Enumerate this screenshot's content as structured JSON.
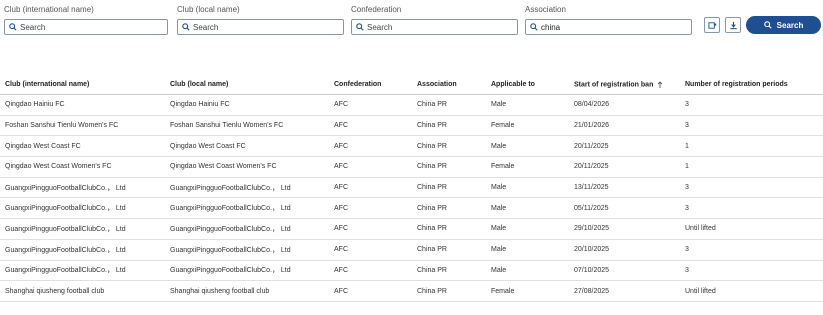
{
  "filters": {
    "club_international": {
      "label": "Club (international name)",
      "placeholder": "Search",
      "value": ""
    },
    "club_local": {
      "label": "Club (local name)",
      "placeholder": "Search",
      "value": ""
    },
    "confederation": {
      "label": "Confederation",
      "placeholder": "Search",
      "value": ""
    },
    "association": {
      "label": "Association",
      "placeholder": "Search",
      "value": "china"
    },
    "search_button": "Search"
  },
  "colors": {
    "accent": "#1f4f91",
    "border": "#8a96a8"
  },
  "table": {
    "headers": {
      "club_international": "Club (international name)",
      "club_local": "Club (local name)",
      "confederation": "Confederation",
      "association": "Association",
      "applicable_to": "Applicable to",
      "start_ban": "Start of registration ban",
      "periods": "Number of registration periods"
    },
    "rows": [
      {
        "club_international": "Qingdao Hainiu FC",
        "club_local": "Qingdao Hainiu FC",
        "confederation": "AFC",
        "association": "China PR",
        "applicable_to": "Male",
        "start_ban": "08/04/2026",
        "periods": "3"
      },
      {
        "club_international": "Foshan Sanshui Tienlu Women's FC",
        "club_local": "Foshan Sanshui Tienlu Women's FC",
        "confederation": "AFC",
        "association": "China PR",
        "applicable_to": "Female",
        "start_ban": "21/01/2026",
        "periods": "3"
      },
      {
        "club_international": "Qingdao West Coast FC",
        "club_local": "Qingdao West Coast FC",
        "confederation": "AFC",
        "association": "China PR",
        "applicable_to": "Male",
        "start_ban": "20/11/2025",
        "periods": "1"
      },
      {
        "club_international": "Qingdao West Coast Women's FC",
        "club_local": "Qingdao West Coast Women's FC",
        "confederation": "AFC",
        "association": "China PR",
        "applicable_to": "Female",
        "start_ban": "20/11/2025",
        "periods": "1"
      },
      {
        "club_international": "GuangxiPingguoFootballClubCo.， Ltd",
        "club_local": "GuangxiPingguoFootballClubCo.， Ltd",
        "confederation": "AFC",
        "association": "China PR",
        "applicable_to": "Male",
        "start_ban": "13/11/2025",
        "periods": "3"
      },
      {
        "club_international": "GuangxiPingguoFootballClubCo.， Ltd",
        "club_local": "GuangxiPingguoFootballClubCo.， Ltd",
        "confederation": "AFC",
        "association": "China PR",
        "applicable_to": "Male",
        "start_ban": "05/11/2025",
        "periods": "3"
      },
      {
        "club_international": "GuangxiPingguoFootballClubCo.， Ltd",
        "club_local": "GuangxiPingguoFootballClubCo.， Ltd",
        "confederation": "AFC",
        "association": "China PR",
        "applicable_to": "Male",
        "start_ban": "29/10/2025",
        "periods": "Until lifted"
      },
      {
        "club_international": "GuangxiPingguoFootballClubCo.， Ltd",
        "club_local": "GuangxiPingguoFootballClubCo.， Ltd",
        "confederation": "AFC",
        "association": "China PR",
        "applicable_to": "Male",
        "start_ban": "20/10/2025",
        "periods": "3"
      },
      {
        "club_international": "GuangxiPingguoFootballClubCo.， Ltd",
        "club_local": "GuangxiPingguoFootballClubCo.， Ltd",
        "confederation": "AFC",
        "association": "China PR",
        "applicable_to": "Male",
        "start_ban": "07/10/2025",
        "periods": "3"
      },
      {
        "club_international": "Shanghai qiusheng football club",
        "club_local": "Shanghai qiusheng football club",
        "confederation": "AFC",
        "association": "China PR",
        "applicable_to": "Female",
        "start_ban": "27/08/2025",
        "periods": "Until lifted"
      }
    ]
  }
}
